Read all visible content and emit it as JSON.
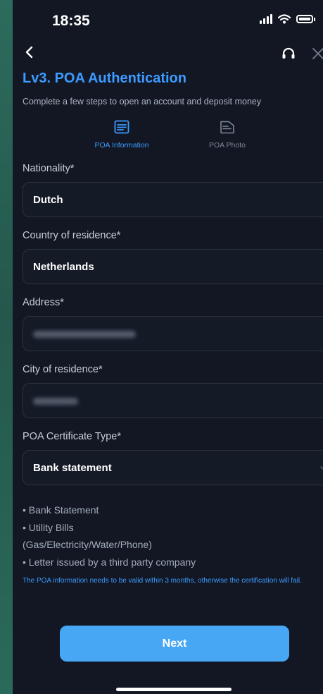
{
  "status_bar": {
    "time": "18:35"
  },
  "header": {
    "title": "Lv3. POA Authentication",
    "subtitle": "Complete a few steps to open an account and deposit money"
  },
  "steps": [
    {
      "label": "POA Information",
      "active": true,
      "icon": "document-lines-icon"
    },
    {
      "label": "POA Photo",
      "active": false,
      "icon": "document-photo-icon"
    }
  ],
  "form": {
    "nationality": {
      "label": "Nationality*",
      "value": "Dutch"
    },
    "country": {
      "label": "Country of residence*",
      "value": "Netherlands"
    },
    "address": {
      "label": "Address*",
      "value_hidden": true
    },
    "city": {
      "label": "City of residence*",
      "value_hidden": true
    },
    "certificate_type": {
      "label": "POA Certificate Type*",
      "value": "Bank statement"
    }
  },
  "certificate_list": [
    "• Bank Statement",
    "• Utility Bills",
    "(Gas/Electricity/Water/Phone)",
    "• Letter issued by a third party company"
  ],
  "notice": "The POA information needs to be valid within 3 months, otherwise the certification will fail.",
  "next_button": {
    "label": "Next"
  },
  "colors": {
    "accent": "#3d9bff",
    "button": "#47a7f5",
    "background": "#121723",
    "outer_background": "#2c6b5d"
  }
}
